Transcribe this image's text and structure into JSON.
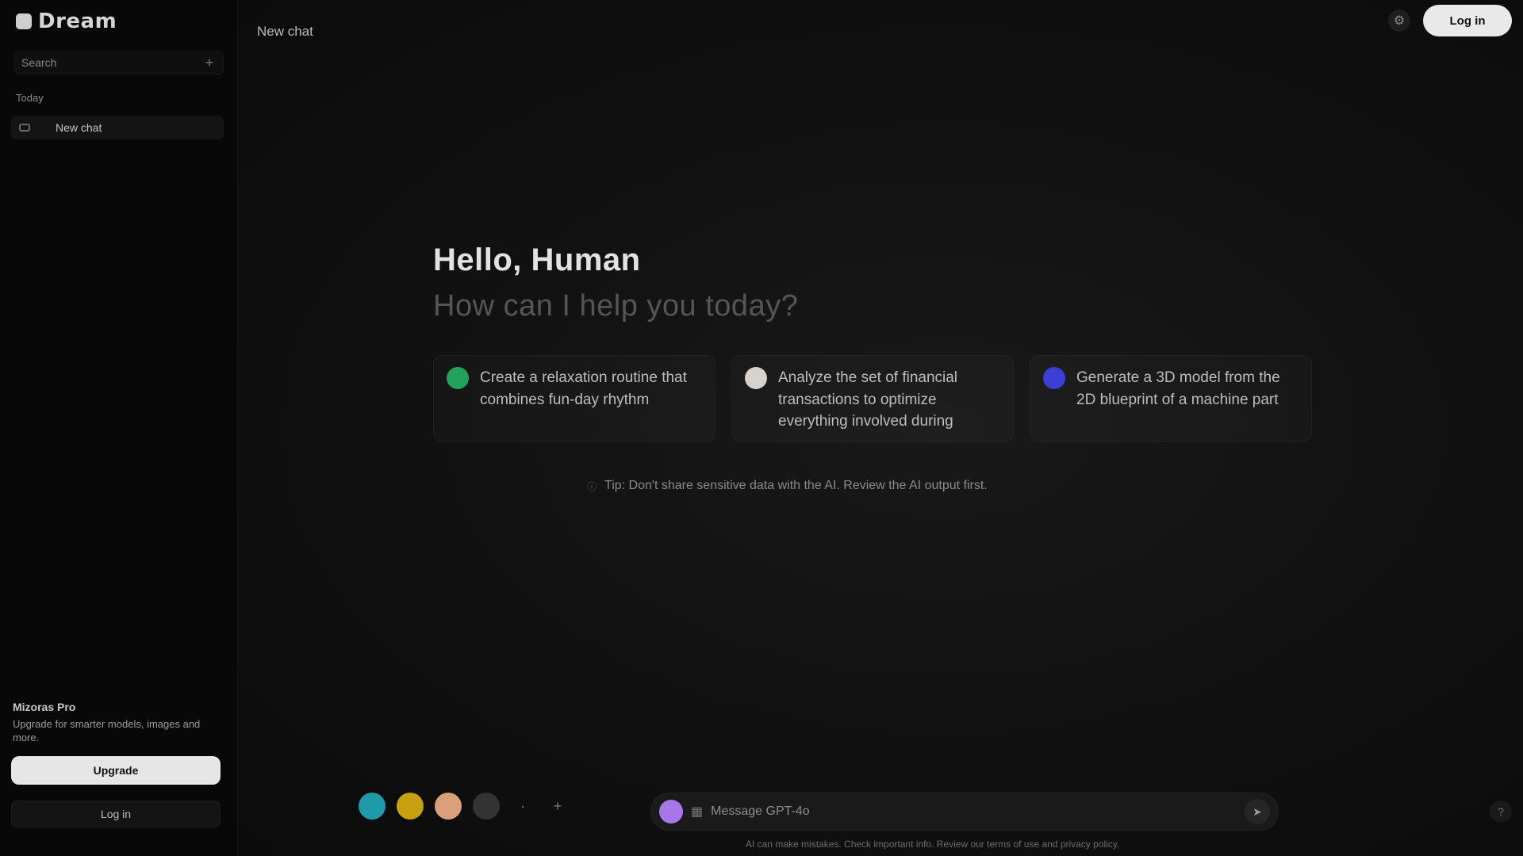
{
  "sidebar": {
    "brand": "Dream",
    "search_placeholder": "Search",
    "new_chat_icon": "plus-icon",
    "section_label": "Today",
    "chats": [
      {
        "label": "New chat"
      }
    ],
    "upgrade": {
      "title": "Mizoras Pro",
      "text": "Upgrade for smarter models, images and more.",
      "button": "Upgrade"
    },
    "login_button": "Log in"
  },
  "main": {
    "page_title": "New chat",
    "login_button": "Log in",
    "greeting": "Hello, Human",
    "subgreeting": "How can I help you today?",
    "suggestions": [
      {
        "text": "Create a relaxation routine that combines fun-day rhythm",
        "icon_color": "#22a35a"
      },
      {
        "text": "Analyze the set of financial transactions to optimize everything involved during",
        "icon_color": "#d8d2cc"
      },
      {
        "text": "Generate a 3D model from the 2D blueprint of a machine part",
        "icon_color": "#3b3fd8"
      }
    ],
    "tip": "Tip: Don't share sensitive data with the AI. Review the AI output first.",
    "models": [
      {
        "name": "model-1",
        "color": "#1f9aa8",
        "label": ""
      },
      {
        "name": "model-2",
        "color": "#c8a10f",
        "label": ""
      },
      {
        "name": "model-3",
        "color": "#d9a07a",
        "label": ""
      },
      {
        "name": "model-4",
        "color": "#333333",
        "label": ""
      }
    ],
    "composer_placeholder": "Message GPT-4o",
    "disclaimer": "AI can make mistakes. Check important info. Review our terms of use and privacy policy."
  },
  "colors": {
    "background": "#0c0c0c",
    "sidebar": "#080808",
    "accent": "#a677e6"
  }
}
